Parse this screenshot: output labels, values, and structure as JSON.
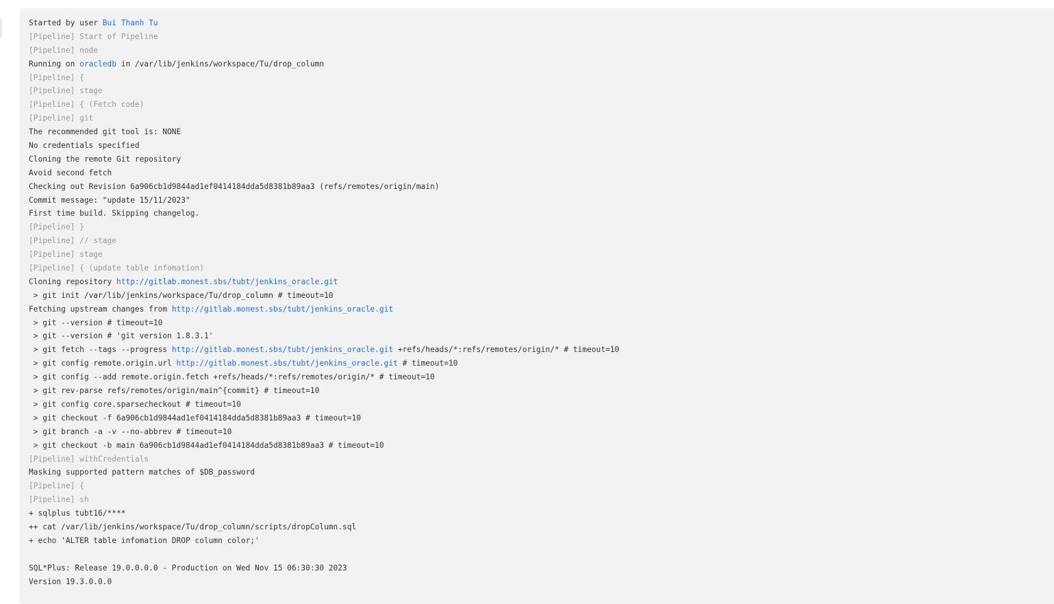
{
  "console": {
    "lines": [
      {
        "type": "normal",
        "parts": [
          {
            "text": "Started by user "
          },
          {
            "text": "Bui Thanh Tu",
            "link": true
          }
        ]
      },
      {
        "type": "pipeline",
        "parts": [
          {
            "text": "[Pipeline] Start of Pipeline"
          }
        ]
      },
      {
        "type": "pipeline",
        "parts": [
          {
            "text": "[Pipeline] node"
          }
        ]
      },
      {
        "type": "normal",
        "parts": [
          {
            "text": "Running on "
          },
          {
            "text": "oracledb",
            "link": true
          },
          {
            "text": " in /var/lib/jenkins/workspace/Tu/drop_column"
          }
        ]
      },
      {
        "type": "pipeline",
        "parts": [
          {
            "text": "[Pipeline] {"
          }
        ]
      },
      {
        "type": "pipeline",
        "parts": [
          {
            "text": "[Pipeline] stage"
          }
        ]
      },
      {
        "type": "pipeline",
        "parts": [
          {
            "text": "[Pipeline] { (Fetch code)"
          }
        ]
      },
      {
        "type": "pipeline",
        "parts": [
          {
            "text": "[Pipeline] git"
          }
        ]
      },
      {
        "type": "normal",
        "parts": [
          {
            "text": "The recommended git tool is: NONE"
          }
        ]
      },
      {
        "type": "normal",
        "parts": [
          {
            "text": "No credentials specified"
          }
        ]
      },
      {
        "type": "normal",
        "parts": [
          {
            "text": "Cloning the remote Git repository"
          }
        ]
      },
      {
        "type": "normal",
        "parts": [
          {
            "text": "Avoid second fetch"
          }
        ]
      },
      {
        "type": "normal",
        "parts": [
          {
            "text": "Checking out Revision 6a906cb1d9844ad1ef0414184dda5d8381b89aa3 (refs/remotes/origin/main)"
          }
        ]
      },
      {
        "type": "normal",
        "parts": [
          {
            "text": "Commit message: \"update 15/11/2023\""
          }
        ]
      },
      {
        "type": "normal",
        "parts": [
          {
            "text": "First time build. Skipping changelog."
          }
        ]
      },
      {
        "type": "pipeline",
        "parts": [
          {
            "text": "[Pipeline] }"
          }
        ]
      },
      {
        "type": "pipeline",
        "parts": [
          {
            "text": "[Pipeline] // stage"
          }
        ]
      },
      {
        "type": "pipeline",
        "parts": [
          {
            "text": "[Pipeline] stage"
          }
        ]
      },
      {
        "type": "pipeline",
        "parts": [
          {
            "text": "[Pipeline] { (update table infomation)"
          }
        ]
      },
      {
        "type": "normal",
        "parts": [
          {
            "text": "Cloning repository "
          },
          {
            "text": "http://gitlab.monest.sbs/tubt/jenkins_oracle.git",
            "link": true
          }
        ]
      },
      {
        "type": "normal",
        "parts": [
          {
            "text": " > git init /var/lib/jenkins/workspace/Tu/drop_column # timeout=10"
          }
        ]
      },
      {
        "type": "normal",
        "parts": [
          {
            "text": "Fetching upstream changes from "
          },
          {
            "text": "http://gitlab.monest.sbs/tubt/jenkins_oracle.git",
            "link": true
          }
        ]
      },
      {
        "type": "normal",
        "parts": [
          {
            "text": " > git --version # timeout=10"
          }
        ]
      },
      {
        "type": "normal",
        "parts": [
          {
            "text": " > git --version # 'git version 1.8.3.1'"
          }
        ]
      },
      {
        "type": "normal",
        "parts": [
          {
            "text": " > git fetch --tags --progress "
          },
          {
            "text": "http://gitlab.monest.sbs/tubt/jenkins_oracle.git",
            "link": true
          },
          {
            "text": " +refs/heads/*:refs/remotes/origin/* # timeout=10"
          }
        ]
      },
      {
        "type": "normal",
        "parts": [
          {
            "text": " > git config remote.origin.url "
          },
          {
            "text": "http://gitlab.monest.sbs/tubt/jenkins_oracle.git",
            "link": true
          },
          {
            "text": " # timeout=10"
          }
        ]
      },
      {
        "type": "normal",
        "parts": [
          {
            "text": " > git config --add remote.origin.fetch +refs/heads/*:refs/remotes/origin/* # timeout=10"
          }
        ]
      },
      {
        "type": "normal",
        "parts": [
          {
            "text": " > git rev-parse refs/remotes/origin/main^{commit} # timeout=10"
          }
        ]
      },
      {
        "type": "normal",
        "parts": [
          {
            "text": " > git config core.sparsecheckout # timeout=10"
          }
        ]
      },
      {
        "type": "normal",
        "parts": [
          {
            "text": " > git checkout -f 6a906cb1d9844ad1ef0414184dda5d8381b89aa3 # timeout=10"
          }
        ]
      },
      {
        "type": "normal",
        "parts": [
          {
            "text": " > git branch -a -v --no-abbrev # timeout=10"
          }
        ]
      },
      {
        "type": "normal",
        "parts": [
          {
            "text": " > git checkout -b main 6a906cb1d9844ad1ef0414184dda5d8381b89aa3 # timeout=10"
          }
        ]
      },
      {
        "type": "pipeline",
        "parts": [
          {
            "text": "[Pipeline] withCredentials"
          }
        ]
      },
      {
        "type": "normal",
        "parts": [
          {
            "text": "Masking supported pattern matches of $DB_password"
          }
        ]
      },
      {
        "type": "pipeline",
        "parts": [
          {
            "text": "[Pipeline] {"
          }
        ]
      },
      {
        "type": "pipeline",
        "parts": [
          {
            "text": "[Pipeline] sh"
          }
        ]
      },
      {
        "type": "normal",
        "parts": [
          {
            "text": "+ sqlplus tubt16/****"
          }
        ]
      },
      {
        "type": "normal",
        "parts": [
          {
            "text": "++ cat /var/lib/jenkins/workspace/Tu/drop_column/scripts/dropColumn.sql"
          }
        ]
      },
      {
        "type": "normal",
        "parts": [
          {
            "text": "+ echo 'ALTER table infomation DROP column color;'"
          }
        ]
      },
      {
        "type": "normal",
        "parts": [
          {
            "text": ""
          }
        ]
      },
      {
        "type": "normal",
        "parts": [
          {
            "text": "SQL*Plus: Release 19.0.0.0.0 - Production on Wed Nov 15 06:30:30 2023"
          }
        ]
      },
      {
        "type": "normal",
        "parts": [
          {
            "text": "Version 19.3.0.0.0"
          }
        ]
      }
    ]
  }
}
